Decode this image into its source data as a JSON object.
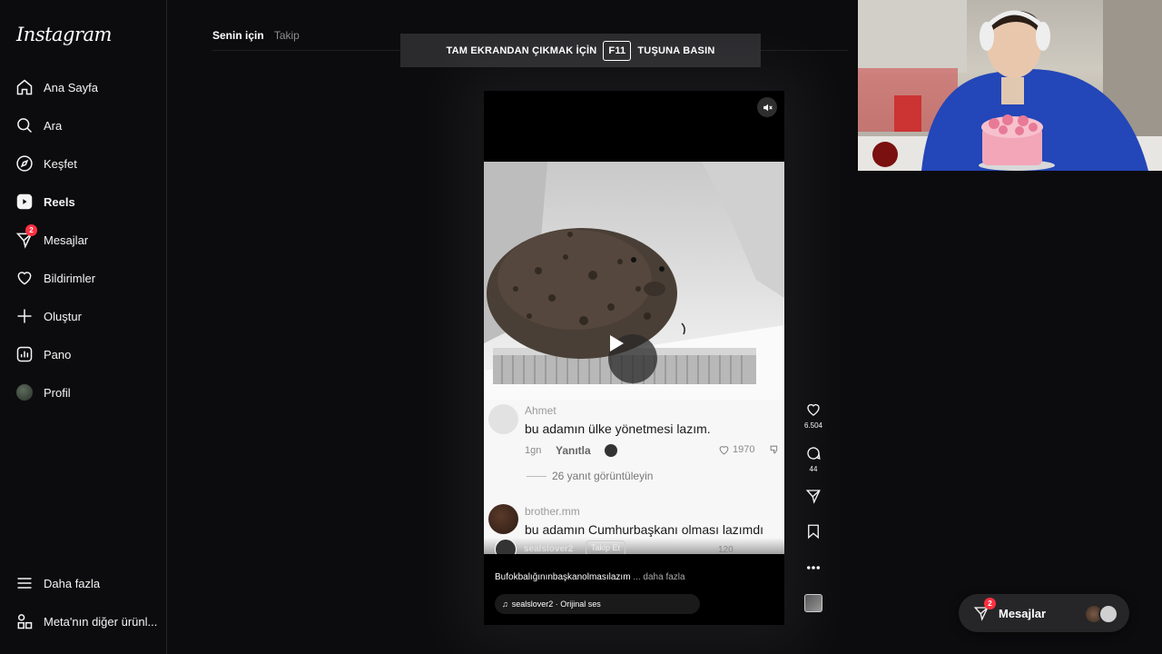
{
  "app": {
    "logo": "Instagram"
  },
  "sidebar": {
    "items": [
      {
        "label": "Ana Sayfa",
        "icon": "home-icon"
      },
      {
        "label": "Ara",
        "icon": "search-icon"
      },
      {
        "label": "Keşfet",
        "icon": "compass-icon"
      },
      {
        "label": "Reels",
        "icon": "reels-icon",
        "active": true
      },
      {
        "label": "Mesajlar",
        "icon": "send-icon",
        "badge": "2"
      },
      {
        "label": "Bildirimler",
        "icon": "heart-icon"
      },
      {
        "label": "Oluştur",
        "icon": "plus-icon"
      },
      {
        "label": "Pano",
        "icon": "dashboard-icon"
      },
      {
        "label": "Profil",
        "icon": "avatar"
      }
    ],
    "bottom": [
      {
        "label": "Daha fazla",
        "icon": "menu-icon"
      },
      {
        "label": "Meta'nın diğer ürünl...",
        "icon": "apps-icon"
      }
    ]
  },
  "feed_tabs": {
    "for_you": "Senin için",
    "following": "Takip"
  },
  "fullscreen_banner": {
    "before": "TAM EKRANDAN ÇIKMAK İÇİN",
    "key": "F11",
    "after": "TUŞUNA BASIN"
  },
  "reel": {
    "comments": [
      {
        "user": "Ahmet",
        "text": "bu adamın ülke yönetmesi lazım.",
        "time": "1gn",
        "reply": "Yanıtla",
        "likes": "1970",
        "replies_link": "26 yanıt görüntüleyin"
      },
      {
        "user": "brother.mm",
        "text": "bu adamın Cumhurbaşkanı olması lazımdı"
      }
    ],
    "overlay_user": "sealslover2",
    "overlay_follow": "Takip Et",
    "overlay_likes": "120",
    "caption": "Bufokbalığınınbaşkanolmasılazım",
    "caption_more": "... daha fazla",
    "audio": "sealslover2 · Orijinal ses"
  },
  "actions": {
    "likes": "6.504",
    "comments": "44"
  },
  "messages_pill": {
    "label": "Mesajlar",
    "badge": "2"
  },
  "colors": {
    "badge": "#ff3040",
    "background": "#0c0c0e",
    "pill": "#262628"
  }
}
